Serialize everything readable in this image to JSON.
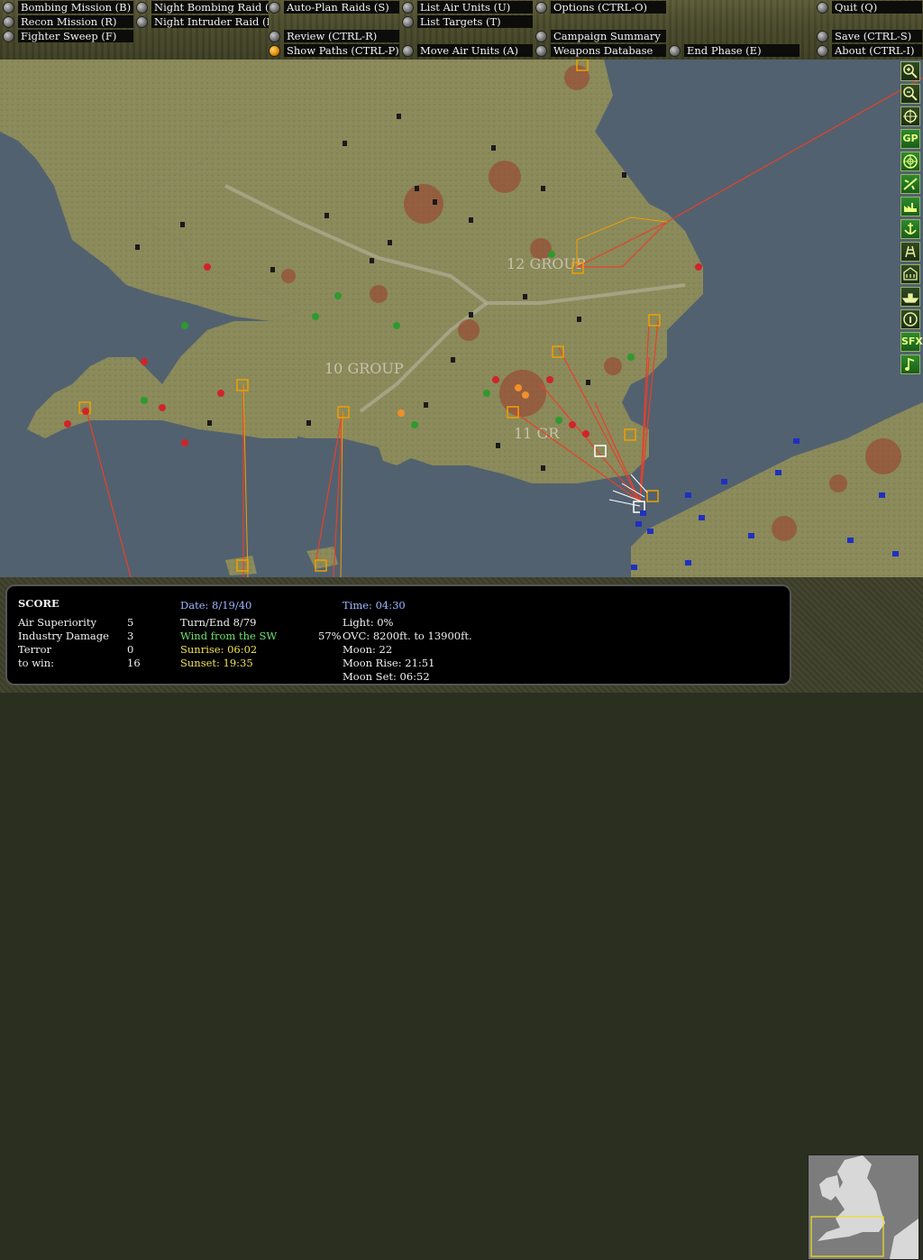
{
  "menu": {
    "bombing_mission": "Bombing Mission (B)",
    "recon_mission": "Recon Mission (R)",
    "fighter_sweep": "Fighter Sweep (F)",
    "night_bombing_raid": "Night Bombing Raid (N)",
    "night_intruder_raid": "Night Intruder Raid (I)",
    "auto_plan_raids": "Auto-Plan Raids (S)",
    "review": "Review (CTRL-R)",
    "show_paths": "Show Paths (CTRL-P)",
    "list_air_units": "List Air Units (U)",
    "list_targets": "List Targets (T)",
    "move_air_units": "Move Air Units (A)",
    "options": "Options (CTRL-O)",
    "campaign_summary": "Campaign Summary",
    "weapons_database": "Weapons Database",
    "end_phase": "End Phase (E)",
    "quit": "Quit (Q)",
    "save": "Save (CTRL-S)",
    "about": "About (CTRL-I)"
  },
  "map": {
    "label_12_group": "12 GROUP",
    "label_10_group": "10 GROUP",
    "label_11_group": "11 GR"
  },
  "toolbar": {
    "gp": "GP",
    "sfx": "SFX"
  },
  "score": {
    "title": "SCORE",
    "air_superiority_label": "Air Superiority",
    "air_superiority_value": "5",
    "industry_damage_label": "Industry Damage",
    "industry_damage_value": "3",
    "terror_label": "Terror",
    "terror_value": "0",
    "to_win_label": "to win:",
    "to_win_value": "16"
  },
  "status": {
    "date": "Date: 8/19/40",
    "turn": "Turn/End 8/79",
    "wind": "Wind from the SW",
    "sunrise": "Sunrise: 06:02",
    "sunset": "Sunset: 19:35"
  },
  "weather": {
    "time": "Time: 04:30",
    "light": "Light: 0%",
    "cloud_pct": "57%",
    "cloud": "OVC: 8200ft. to 13900ft.",
    "moon": "Moon: 22",
    "moon_rise": "Moon Rise: 21:51",
    "moon_set": "Moon Set: 06:52"
  },
  "colors": {
    "sea": "#4d5d6b",
    "land": "#8b8a5c",
    "raid_path": "#e8402a",
    "target_box": "#f0a000",
    "friendly_unit": "#2e9a2e",
    "enemy_unit": "#d0242a",
    "luftwaffe_unit": "#2030c0"
  }
}
